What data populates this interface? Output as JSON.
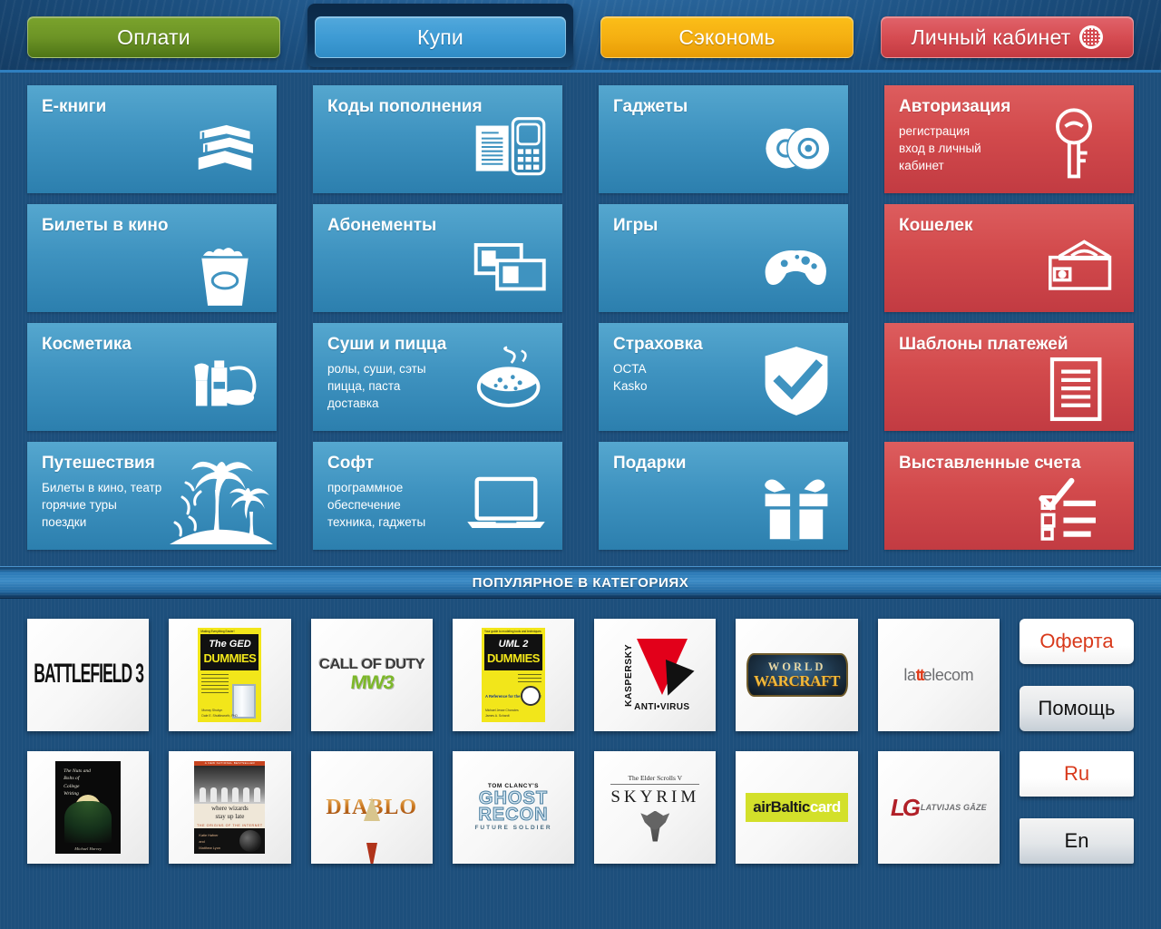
{
  "nav": {
    "tabs": [
      {
        "label": "Оплати",
        "color": "green",
        "active": false
      },
      {
        "label": "Купи",
        "color": "blue",
        "active": true
      },
      {
        "label": "Сэкономь",
        "color": "orange",
        "active": false
      },
      {
        "label": "Личный кабинет",
        "color": "red",
        "active": false,
        "icon": "globe-grid-icon"
      }
    ]
  },
  "tiles": [
    {
      "title": "Е-книги",
      "sub": "",
      "color": "blue",
      "icon": "books-icon"
    },
    {
      "title": "Коды пополнения",
      "sub": "",
      "color": "blue",
      "icon": "document-phone-icon"
    },
    {
      "title": "Гаджеты",
      "sub": "",
      "color": "blue",
      "icon": "discs-icon"
    },
    {
      "title": "Авторизация",
      "sub": "регистрация\nвход в личный\nкабинет",
      "color": "red",
      "icon": "key-icon"
    },
    {
      "title": "Билеты в кино",
      "sub": "",
      "color": "blue",
      "icon": "popcorn-icon"
    },
    {
      "title": "Абонементы",
      "sub": "",
      "color": "blue",
      "icon": "cards-icon"
    },
    {
      "title": "Игры",
      "sub": "",
      "color": "blue",
      "icon": "gamepad-icon"
    },
    {
      "title": "Кошелек",
      "sub": "",
      "color": "red",
      "icon": "wallet-icon"
    },
    {
      "title": "Косметика",
      "sub": "",
      "color": "blue",
      "icon": "cosmetics-icon"
    },
    {
      "title": "Суши и пицца",
      "sub": "ролы, суши, сэты\nпицца, паста\nдоставка",
      "color": "blue",
      "icon": "pizza-icon"
    },
    {
      "title": "Страховка",
      "sub": "OCTA\nKasko",
      "color": "blue",
      "icon": "shield-check-icon"
    },
    {
      "title": "Шаблоны платежей",
      "sub": "",
      "color": "red",
      "icon": "document-lines-icon"
    },
    {
      "title": "Путешествия",
      "sub": "Билеты в кино, театр\nгорячие туры\nпоездки",
      "color": "blue",
      "icon": "palm-island-icon"
    },
    {
      "title": "Софт",
      "sub": "программное\nобеспечение\nтехника, гаджеты",
      "color": "blue",
      "icon": "laptop-icon"
    },
    {
      "title": "Подарки",
      "sub": "",
      "color": "blue",
      "icon": "gift-icon"
    },
    {
      "title": "Выставленные счета",
      "sub": "",
      "color": "red",
      "icon": "checklist-icon"
    }
  ],
  "popular": {
    "heading": "ПОПУЛЯРНОЕ В КАТЕГОРИЯХ"
  },
  "products": [
    {
      "name": "BATTLEFIELD 3",
      "art": "battlefield3"
    },
    {
      "name": "The GED For Dummies",
      "art": "ged-dummies",
      "cover": {
        "top": "Making Everything Easier!",
        "title": "The GED",
        "for": "FOR",
        "brand": "DUMMIES",
        "authors": "Murray Shukyn\nDale E. Shuttleworth, PhD"
      }
    },
    {
      "name": "CALL OF DUTY MW3",
      "art": "cod-mw3",
      "lines": [
        "CALL OF DUTY",
        "MW3"
      ]
    },
    {
      "name": "UML 2 For Dummies",
      "art": "uml2-dummies",
      "cover": {
        "top": "Your guide to modeling tools and techniques",
        "title": "UML 2",
        "for": "FOR",
        "brand": "DUMMIES",
        "tag": "A Reference for the Rest of Us!",
        "authors": "Michael Jesse Chonoles\nJames A. Schardt"
      }
    },
    {
      "name": "KASPERSKY ANTI-VIRUS",
      "art": "kaspersky",
      "lines": [
        "KASPERSKY",
        "ANTI•VIRUS"
      ]
    },
    {
      "name": "WORLD OF WARCRAFT",
      "art": "wow",
      "lines": [
        "WORLD",
        "WARCRAFT"
      ]
    },
    {
      "name": "lattelecom",
      "art": "lattelecom",
      "lines": [
        "la",
        "tt",
        "elecom"
      ]
    },
    {
      "name": "The Nuts and Bolts of College Writing",
      "art": "nuts-bolts",
      "cover": {
        "title": "The Nuts and\nBolts of\nCollege\nWriting",
        "author": "Michael Harvey"
      }
    },
    {
      "name": "where wizards stay up late",
      "art": "wizards",
      "cover": {
        "band": "A NEW NATIONAL BESTSELLER",
        "title": "where wizards\nstay up late",
        "subtitle": "THE ORIGINS OF THE INTERNET",
        "authors": "Katie Hafner\nand\nMatthew Lyon"
      }
    },
    {
      "name": "DIABLO III",
      "art": "diablo3",
      "lines": [
        "DIABLO"
      ]
    },
    {
      "name": "TOM CLANCY'S GHOST RECON FUTURE SOLDIER",
      "art": "ghost-recon",
      "lines": [
        "TOM CLANCY'S",
        "GHOST",
        "RECON",
        "FUTURE SOLDIER"
      ]
    },
    {
      "name": "The Elder Scrolls V SKYRIM",
      "art": "skyrim",
      "lines": [
        "The Elder Scrolls V",
        "SKYRIM"
      ]
    },
    {
      "name": "airBaltic card",
      "art": "airbaltic",
      "lines": [
        "airBaltic",
        "card"
      ]
    },
    {
      "name": "LATVIJAS GĀZE",
      "art": "latvijas-gaze",
      "lines": [
        "LG",
        "LATVIJAS GĀZE"
      ]
    }
  ],
  "side_buttons": [
    {
      "label": "Оферта",
      "style": "white"
    },
    {
      "label": "Помощь",
      "style": "grey"
    },
    {
      "label": "Ru",
      "style": "white"
    },
    {
      "label": "En",
      "style": "grey"
    }
  ],
  "colors": {
    "green": "#6d9426",
    "blue": "#3e9bd4",
    "orange": "#f5b012",
    "red": "#d24a4c",
    "tile_blue": "#3f93c0",
    "tile_red": "#d24a4c",
    "page_bg": "#1d4f7c",
    "offer_text": "#d8391b"
  }
}
